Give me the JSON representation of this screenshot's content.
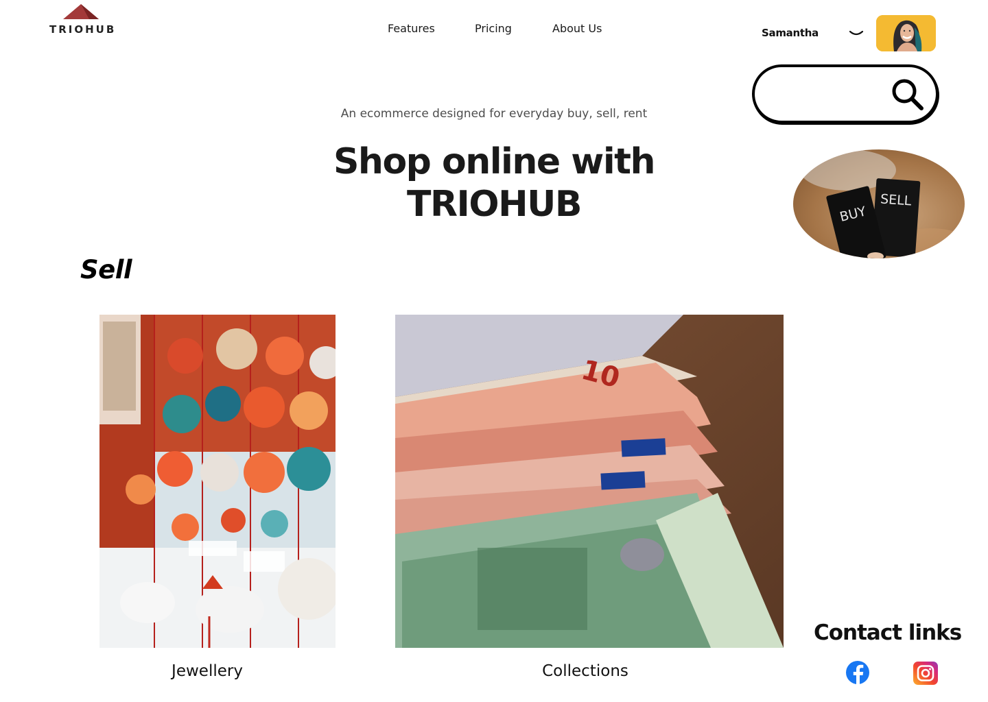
{
  "brand": {
    "name": "TRIOHUB",
    "mark_color": "#8b2e2e"
  },
  "nav": {
    "items": [
      {
        "label": "Features"
      },
      {
        "label": "Pricing"
      },
      {
        "label": "About Us"
      }
    ]
  },
  "user": {
    "name": "Samantha",
    "chevron_icon": "chevron-down-icon",
    "avatar_bg": "#f3b629"
  },
  "search": {
    "value": "",
    "placeholder": "",
    "icon": "search-icon"
  },
  "hero": {
    "tagline": "An ecommerce designed for everyday buy, sell, rent",
    "title_line1": "Shop online with",
    "title_line2": "TRIOHUB"
  },
  "promo_image": {
    "card_left": "BUY",
    "card_right": "SELL"
  },
  "sell": {
    "heading": "Sell",
    "cards": [
      {
        "label": "Jewellery"
      },
      {
        "label": "Collections"
      }
    ]
  },
  "contact": {
    "title": "Contact links",
    "links": [
      {
        "icon": "facebook-icon",
        "color": "#1877f2"
      },
      {
        "icon": "instagram-icon",
        "color": "#e1306c"
      }
    ]
  }
}
